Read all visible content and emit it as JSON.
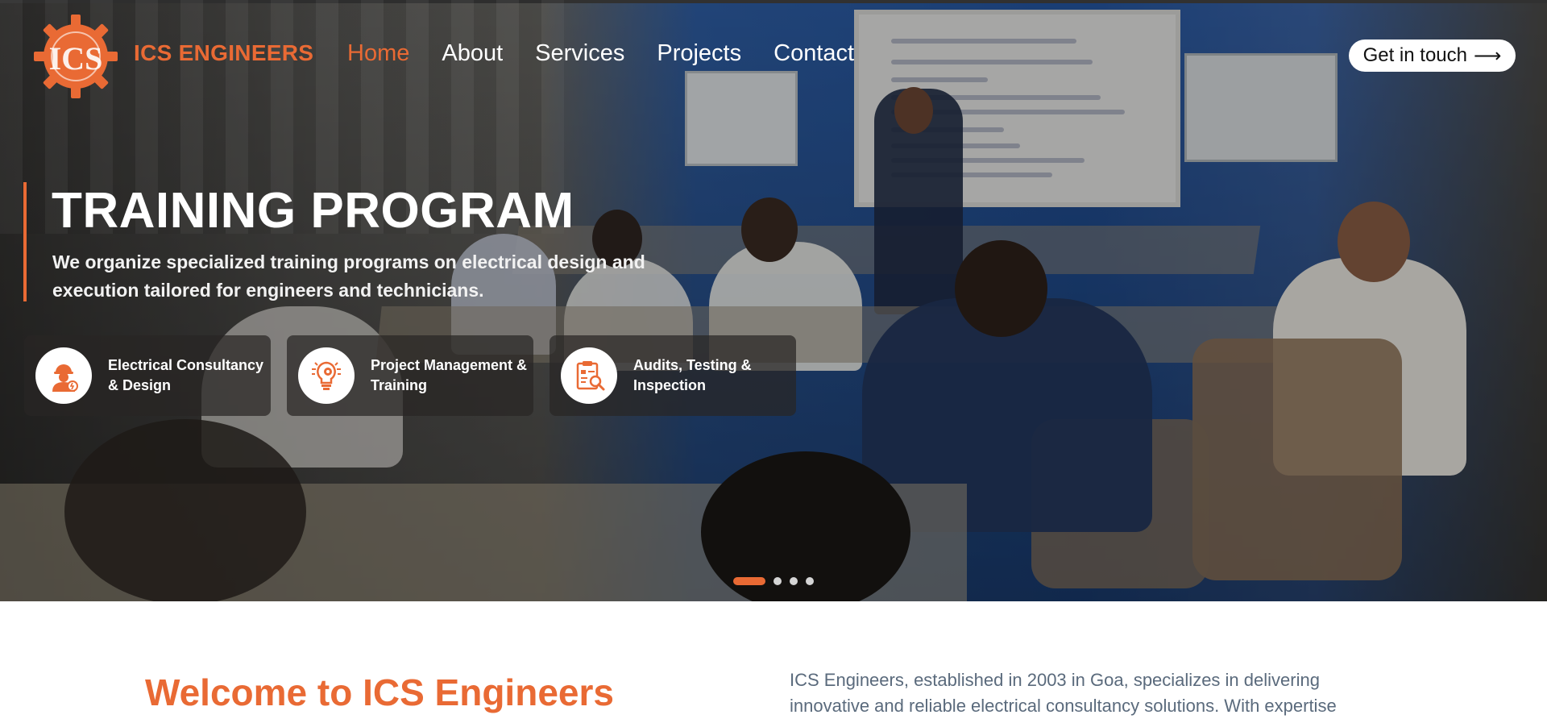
{
  "brand": {
    "name": "ICS ENGINEERS",
    "logo_text": "ICS",
    "accent_color": "#e96a34"
  },
  "nav": {
    "items": [
      {
        "label": "Home",
        "active": true
      },
      {
        "label": "About",
        "active": false
      },
      {
        "label": "Services",
        "active": false
      },
      {
        "label": "Projects",
        "active": false
      },
      {
        "label": "Contact",
        "active": false
      }
    ],
    "cta_label": "Get in touch",
    "cta_icon": "arrow-right-icon"
  },
  "hero": {
    "title": "TRAINING PROGRAM",
    "description": "We organize specialized training programs on electrical design and execution tailored for engineers and technicians.",
    "cards": [
      {
        "label": "Electrical Consultancy & Design",
        "icon": "engineer-icon"
      },
      {
        "label": "Project Management & Training",
        "icon": "lightbulb-gear-icon"
      },
      {
        "label": "Audits, Testing & Inspection",
        "icon": "clipboard-search-icon"
      }
    ],
    "slides_total": 4,
    "slide_active": 1
  },
  "welcome": {
    "title": "Welcome to ICS Engineers",
    "text": "ICS Engineers, established in 2003 in Goa, specializes in delivering innovative and reliable electrical consultancy solutions. With expertise"
  }
}
